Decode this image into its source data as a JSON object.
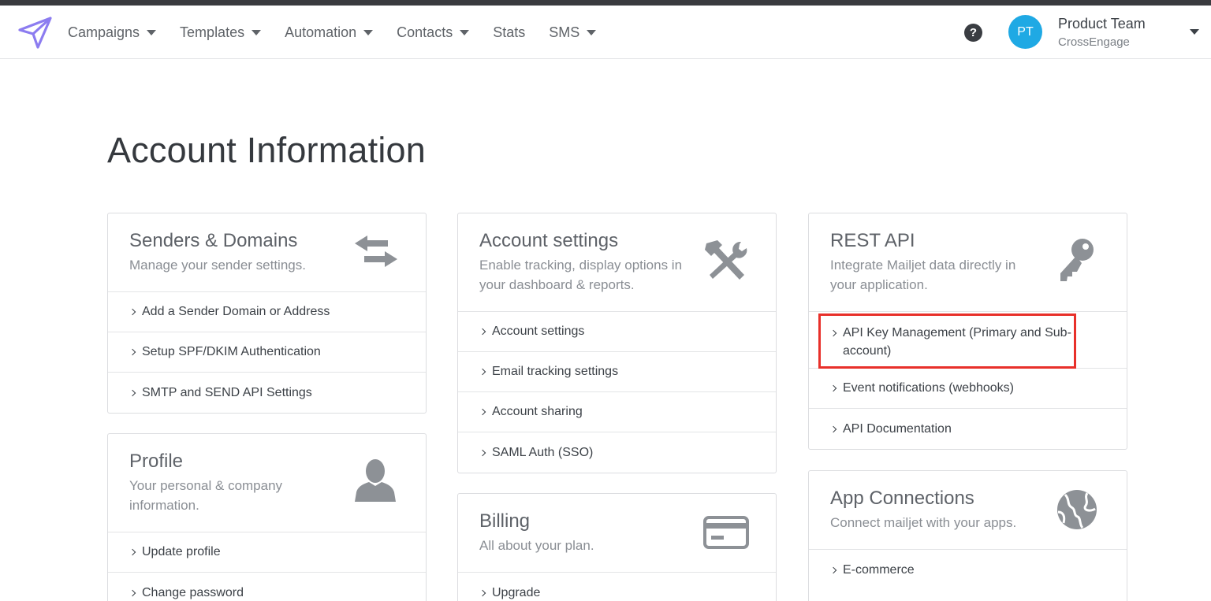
{
  "nav": {
    "items": [
      {
        "label": "Campaigns",
        "dropdown": true
      },
      {
        "label": "Templates",
        "dropdown": true
      },
      {
        "label": "Automation",
        "dropdown": true
      },
      {
        "label": "Contacts",
        "dropdown": true
      },
      {
        "label": "Stats",
        "dropdown": false
      },
      {
        "label": "SMS",
        "dropdown": true
      }
    ],
    "help_label": "?",
    "user": {
      "initials": "PT",
      "name": "Product Team",
      "org": "CrossEngage"
    },
    "accent_color": "#1fa9e4",
    "logo_color": "#8c7cf0"
  },
  "page": {
    "title": "Account Information"
  },
  "cards": {
    "senders": {
      "title": "Senders & Domains",
      "desc": "Manage your sender settings.",
      "icon": "transfer-arrows-icon",
      "links": [
        "Add a Sender Domain or Address",
        "Setup SPF/DKIM Authentication",
        "SMTP and SEND API Settings"
      ]
    },
    "profile": {
      "title": "Profile",
      "desc": "Your personal & company information.",
      "icon": "user-silhouette-icon",
      "links": [
        "Update profile",
        "Change password"
      ]
    },
    "account": {
      "title": "Account settings",
      "desc": "Enable tracking, display options in your dashboard & reports.",
      "icon": "tools-icon",
      "links": [
        "Account settings",
        "Email tracking settings",
        "Account sharing",
        "SAML Auth (SSO)"
      ]
    },
    "billing": {
      "title": "Billing",
      "desc": "All about your plan.",
      "icon": "credit-card-icon",
      "links": [
        "Upgrade"
      ]
    },
    "restapi": {
      "title": "REST API",
      "desc": "Integrate Mailjet data directly in your application.",
      "icon": "key-icon",
      "links": [
        "API Key Management (Primary and Sub-account)",
        "Event notifications (webhooks)",
        "API Documentation"
      ]
    },
    "apps": {
      "title": "App Connections",
      "desc": "Connect mailjet with your apps.",
      "icon": "globe-icon",
      "links": [
        "E-commerce"
      ]
    }
  },
  "highlight_color": "#e8302a"
}
